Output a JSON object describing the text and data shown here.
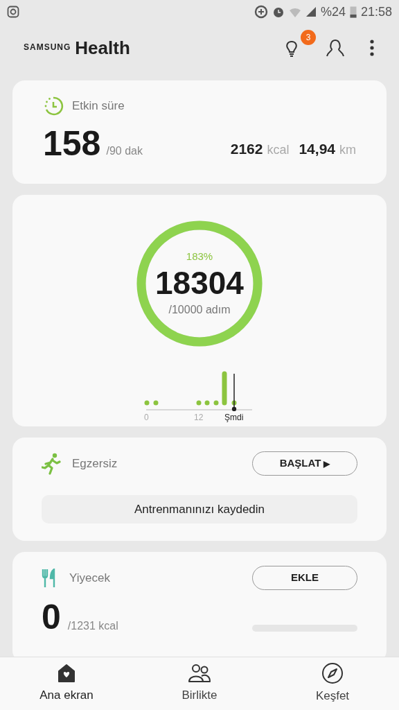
{
  "status_bar": {
    "battery": "%24",
    "time": "21:58"
  },
  "header": {
    "brand_small": "SAMSUNG",
    "brand_large": "Health",
    "notification_count": "3"
  },
  "active_time": {
    "title": "Etkin süre",
    "value": "158",
    "goal": "/90 dak",
    "calories": "2162",
    "calories_unit": "kcal",
    "distance": "14,94",
    "distance_unit": "km"
  },
  "steps": {
    "percent": "183%",
    "value": "18304",
    "goal": "/10000 adım",
    "axis_labels": [
      "0",
      "12",
      "Şmdi"
    ]
  },
  "exercise": {
    "title": "Egzersiz",
    "button": "BAŞLAT",
    "button_icon": "▶",
    "record": "Antrenmanınızı kaydedin"
  },
  "food": {
    "title": "Yiyecek",
    "button": "EKLE",
    "value": "0",
    "goal": "/1231 kcal"
  },
  "bottom_nav": [
    {
      "label": "Ana ekran",
      "kind": "home",
      "selected": true
    },
    {
      "label": "Birlikte",
      "kind": "people",
      "selected": false
    },
    {
      "label": "Keşfet",
      "kind": "compass",
      "selected": false
    }
  ]
}
